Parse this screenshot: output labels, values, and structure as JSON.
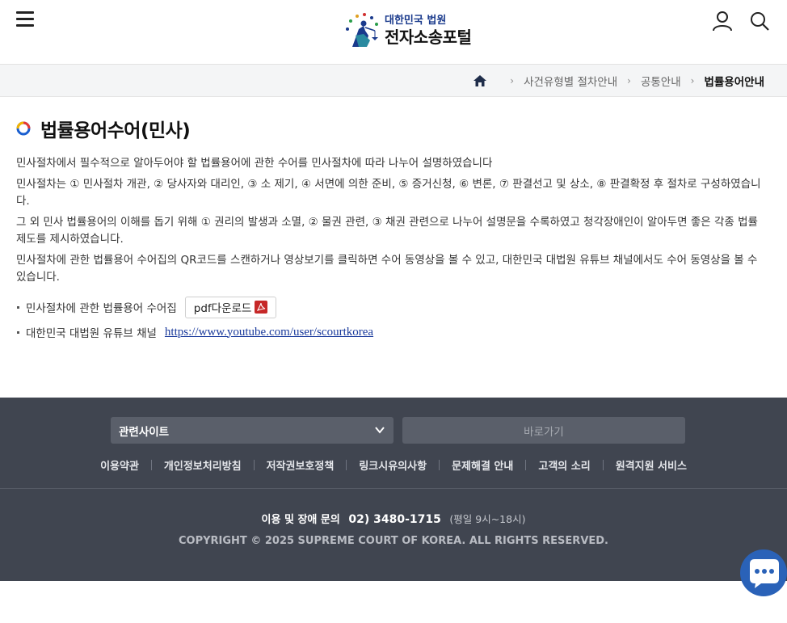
{
  "header": {
    "logo_sub": "대한민국 법원",
    "logo_main": "전자소송포털",
    "menu_icon": "hamburger-menu-icon",
    "user_icon": "user-icon",
    "search_icon": "search-icon"
  },
  "breadcrumb": {
    "home_icon": "home-icon",
    "items": [
      "사건유형별 절차안내",
      "공통안내",
      "법률용어안내"
    ]
  },
  "page": {
    "title": "법률용어수어(민사)",
    "paragraphs": [
      "민사절차에서 필수적으로 알아두어야 할 법률용어에 관한 수어를 민사절차에 따라 나누어 설명하였습니다",
      "민사절차는 ① 민사절차 개관, ② 당사자와 대리인, ③ 소 제기, ④ 서면에 의한 준비, ⑤ 증거신청, ⑥ 변론, ⑦ 판결선고 및 상소, ⑧ 판결확정 후 절차로 구성하였습니다.",
      "그 외 민사 법률용어의 이해를 돕기 위해 ① 권리의 발생과 소멸, ② 물권 관련, ③ 채권 관련으로 나누어 설명문을 수록하였고 청각장애인이 알아두면 좋은 각종 법률 제도를 제시하였습니다.",
      "민사절차에 관한 법률용어 수어집의 QR코드를 스캔하거나 영상보기를 클릭하면 수어 동영상을 볼 수 있고, 대한민국 대법원 유튜브 채널에서도 수어 동영상을 볼 수 있습니다."
    ],
    "links": {
      "pdf_label": "민사절차에 관한 법률용어 수어집",
      "pdf_button": "pdf다운로드",
      "youtube_label": "대한민국 대법원 유튜브 채널",
      "youtube_url": "https://www.youtube.com/user/scourtkorea"
    }
  },
  "footer": {
    "related_sites": "관련사이트",
    "go_button": "바로가기",
    "links": [
      "이용약관",
      "개인정보처리방침",
      "저작권보호정책",
      "링크시유의사항",
      "문제해결 안내",
      "고객의 소리",
      "원격지원 서비스"
    ],
    "contact_label": "이용 및 장애 문의",
    "phone": "02) 3480-1715",
    "hours": "(평일 9시~18시)",
    "copyright": "COPYRIGHT © 2025 SUPREME COURT OF KOREA. ALL RIGHTS RESERVED."
  },
  "colors": {
    "footer_bg": "#404550",
    "accent_blue": "#1a3a9c",
    "chat_blue": "#2a62b8"
  }
}
